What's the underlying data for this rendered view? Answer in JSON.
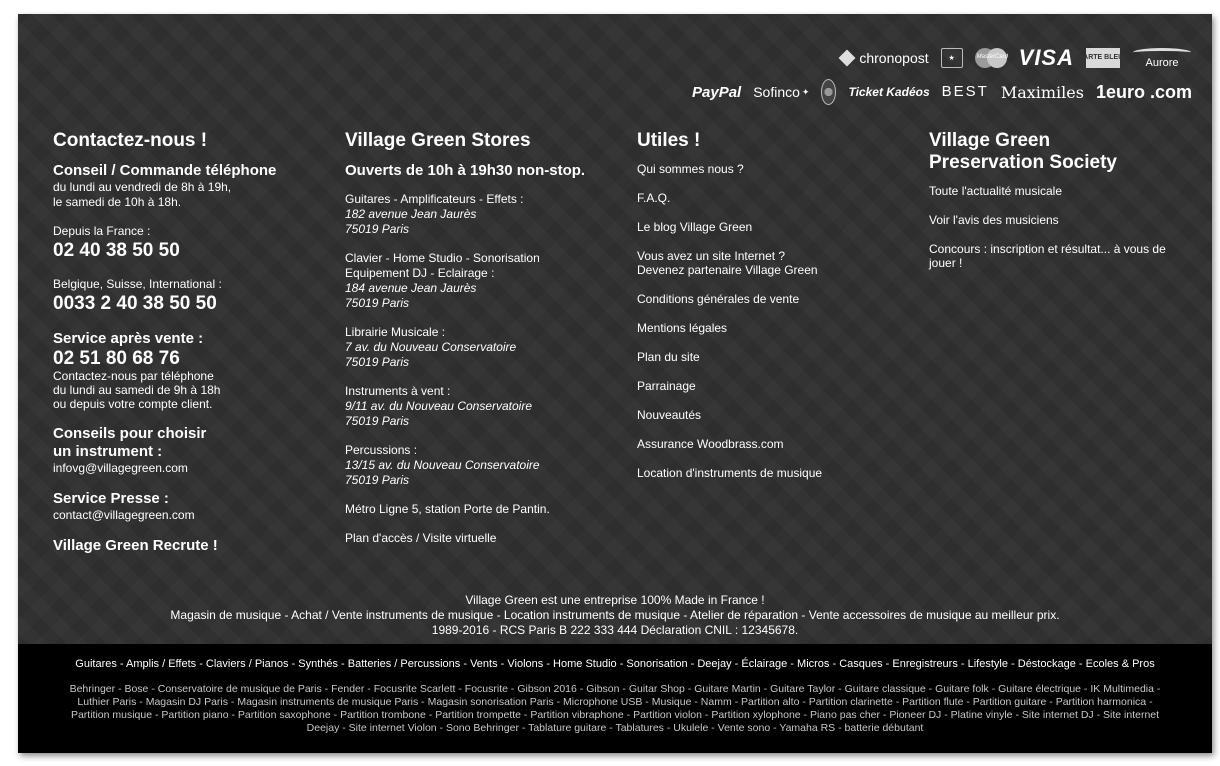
{
  "logos": {
    "row1": [
      "chronopost",
      "MasterCard",
      "VISA",
      "CARTE BLEUE",
      "Aurore"
    ],
    "row2": [
      "PayPal",
      "Sofinco",
      "Ticket Kadéos",
      "BEST",
      "Maximiles",
      "1euro .com"
    ]
  },
  "contact": {
    "title": "Contactez-nous !",
    "phone_heading": "Conseil / Commande téléphone",
    "phone_hours_1": "du lundi au vendredi de 8h à 19h,",
    "phone_hours_2": "le samedi de 10h à 18h.",
    "france_label": "Depuis la France :",
    "france_number": "02 40 38 50 50",
    "intl_label": "Belgique, Suisse, International :",
    "intl_number": "0033 2 40 38 50 50",
    "sav_heading": "Service après vente :",
    "sav_number": "02 51 80 68 76",
    "sav_note_1": "Contactez-nous par téléphone",
    "sav_note_2": "du lundi au samedi de 9h à 18h",
    "sav_note_3": "ou depuis votre compte client.",
    "advice_heading_1": "Conseils pour choisir",
    "advice_heading_2": "un instrument :",
    "advice_email": "infovg@villagegreen.com",
    "press_heading": "Service Presse :",
    "press_email": "contact@villagegreen.com",
    "jobs": "Village Green Recrute !"
  },
  "stores": {
    "title": "Village Green Stores",
    "hours": "Ouverts de 10h à 19h30 non-stop.",
    "s1_name": "Guitares - Amplificateurs - Effets :",
    "s1_addr1": "182 avenue Jean Jaurès",
    "s1_addr2": "75019 Paris",
    "s2_name_1": "Clavier - Home Studio - Sonorisation",
    "s2_name_2": "Equipement DJ - Eclairage :",
    "s2_addr1": "184 avenue Jean Jaurès",
    "s2_addr2": "75019 Paris",
    "s3_name": "Librairie Musicale :",
    "s3_addr1": "7 av. du Nouveau Conservatoire",
    "s3_addr2": "75019 Paris",
    "s4_name": "Instruments à vent :",
    "s4_addr1": "9/11 av. du Nouveau Conservatoire",
    "s4_addr2": "75019 Paris",
    "s5_name": "Percussions :",
    "s5_addr1": "13/15 av. du Nouveau Conservatoire",
    "s5_addr2": "75019 Paris",
    "metro": "Métro Ligne 5, station Porte de Pantin.",
    "map_link": "Plan d'accès / Visite virtuelle"
  },
  "useful": {
    "title": "Utiles !",
    "links": [
      "Qui sommes nous ?",
      "F.A.Q.",
      "Le blog Village Green",
      "Vous avez un site Internet ?",
      "Devenez partenaire Village Green",
      "Conditions générales de vente",
      "Mentions légales",
      "Plan du site",
      "Parrainage",
      "Nouveautés",
      "Assurance Woodbrass.com",
      "Location d'instruments de musique"
    ]
  },
  "society": {
    "title_1": "Village Green",
    "title_2": "Preservation Society",
    "links": [
      "Toute l'actualité musicale",
      "Voir l'avis des musiciens",
      "Concours : inscription et résultat... à vous de jouer !"
    ]
  },
  "company": {
    "line1": "Village Green est une entreprise 100% Made in France !",
    "line2": "Magasin de musique - Achat / Vente instruments de musique - Location instruments de musique - Atelier de réparation - Vente accessoires de musique au meilleur prix.",
    "line3": "1989-2016 - RCS Paris B 222 333 444 Déclaration CNIL : 12345678."
  },
  "categories": [
    "Guitares",
    "Amplis / Effets",
    "Claviers / Pianos",
    "Synthés",
    "Batteries / Percussions",
    "Vents",
    "Violons",
    "Home Studio",
    "Sonorisation",
    "Deejay",
    "Éclairage",
    "Micros",
    "Casques",
    "Enregistreurs",
    "Lifestyle",
    "Déstockage",
    "Ecoles & Pros"
  ],
  "seo_links": [
    "Behringer",
    "Bose",
    "Conservatoire de musique de Paris",
    "Fender",
    "Focusrite Scarlett",
    "Focusrite",
    "Gibson 2016",
    "Gibson",
    "Guitar Shop",
    "Guitare Martin",
    "Guitare Taylor",
    "Guitare classique",
    "Guitare folk",
    "Guitare électrique",
    "IK Multimedia",
    "Luthier Paris",
    "Magasin DJ Paris",
    "Magasin instruments de musique Paris",
    "Magasin sonorisation Paris",
    "Microphone USB",
    "Musique",
    "Namm",
    "Partition alto",
    "Partition clarinette",
    "Partition flute",
    "Partition guitare",
    "Partition harmonica",
    "Partition musique",
    "Partition piano",
    "Partition saxophone",
    "Partition trombone",
    "Partition trompette",
    "Partition vibraphone",
    "Partition violon",
    "Partition xylophone",
    "Piano pas cher",
    "Pioneer DJ",
    "Platine vinyle",
    "Site internet DJ",
    "Site internet Deejay",
    "Site internet Violon",
    "Sono Behringer",
    "Tablature guitare",
    "Tablatures",
    "Ukulele",
    "Vente sono",
    "Yamaha RS",
    "batterie débutant"
  ]
}
